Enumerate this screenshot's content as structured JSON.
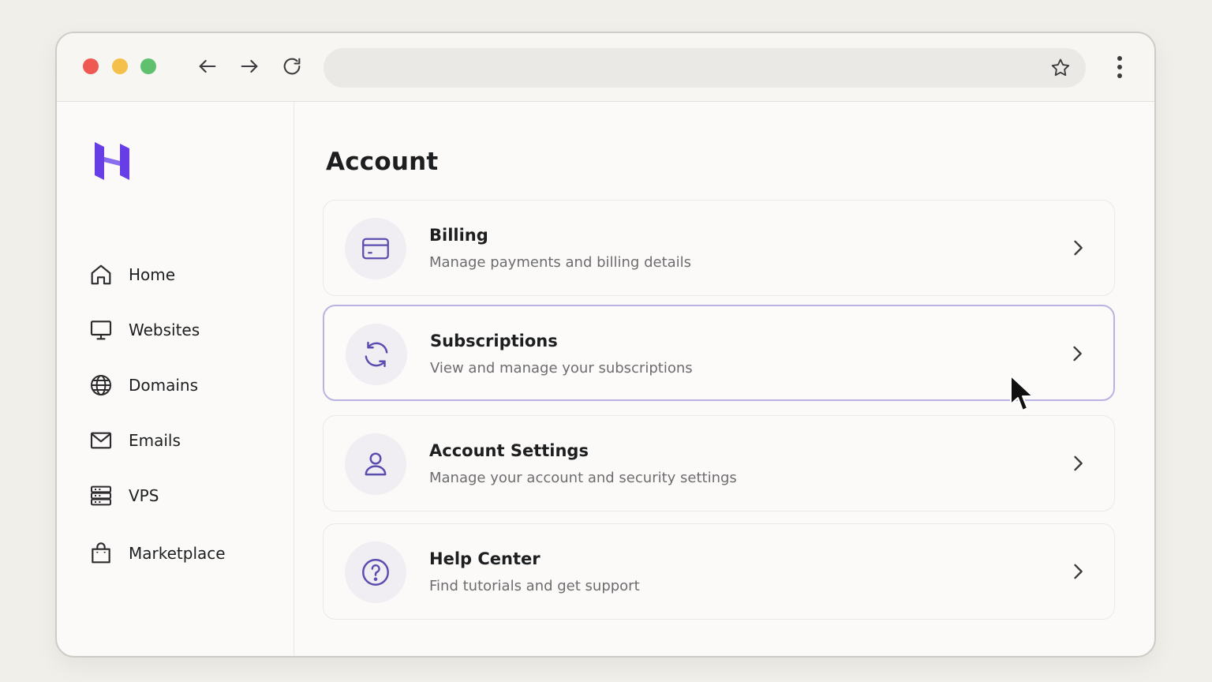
{
  "colors": {
    "brand": "#673de6",
    "icon_purple": "#5b4caf",
    "traffic_red": "#ee5a52",
    "traffic_yellow": "#f4c04a",
    "traffic_green": "#5fc16f"
  },
  "browser": {
    "back_icon": "arrow-left-icon",
    "forward_icon": "arrow-right-icon",
    "reload_icon": "reload-icon",
    "bookmark_icon": "star-icon",
    "menu_icon": "kebab-menu-icon",
    "address_value": ""
  },
  "sidebar": {
    "logo": "hostinger-logo",
    "items": [
      {
        "label": "Home",
        "icon": "home-icon"
      },
      {
        "label": "Websites",
        "icon": "monitor-icon"
      },
      {
        "label": "Domains",
        "icon": "globe-icon"
      },
      {
        "label": "Emails",
        "icon": "mail-icon"
      },
      {
        "label": "VPS",
        "icon": "server-icon"
      },
      {
        "label": "Marketplace",
        "icon": "shopping-bag-icon"
      }
    ]
  },
  "main": {
    "title": "Account",
    "cards": [
      {
        "title": "Billing",
        "subtitle": "Manage payments and billing details",
        "icon": "credit-card-icon"
      },
      {
        "title": "Subscriptions",
        "subtitle": "View and manage your subscriptions",
        "icon": "refresh-icon"
      },
      {
        "title": "Account Settings",
        "subtitle": "Manage your account and security settings",
        "icon": "user-icon"
      },
      {
        "title": "Help Center",
        "subtitle": "Find tutorials and get support",
        "icon": "help-circle-icon"
      }
    ]
  }
}
